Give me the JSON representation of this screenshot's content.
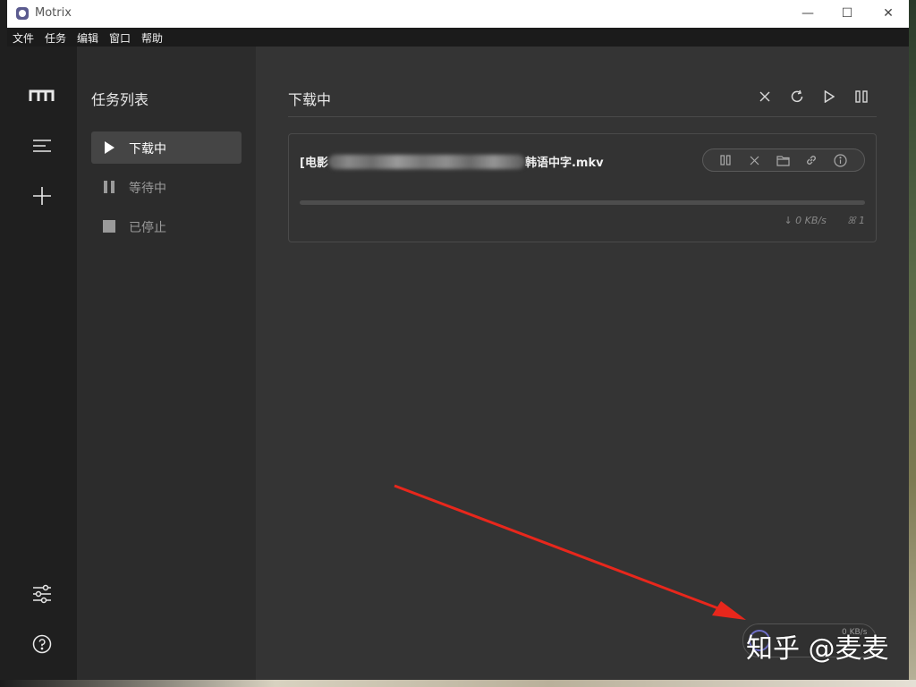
{
  "window": {
    "title": "Motrix",
    "minimize_glyph": "—",
    "maximize_glyph": "☐",
    "close_glyph": "✕"
  },
  "menubar": {
    "items": [
      "文件",
      "任务",
      "编辑",
      "窗口",
      "帮助"
    ]
  },
  "rail": {
    "icons": [
      "motrix-logo-icon",
      "menu-icon",
      "add-icon",
      "preferences-icon",
      "help-icon"
    ]
  },
  "task_panel": {
    "title": "任务列表",
    "items": [
      {
        "label": "下载中",
        "icon": "play-icon",
        "active": true
      },
      {
        "label": "等待中",
        "icon": "pause-icon",
        "active": false
      },
      {
        "label": "已停止",
        "icon": "stop-icon",
        "active": false
      }
    ]
  },
  "main": {
    "title": "下载中",
    "toolbar": [
      "close-icon",
      "refresh-icon",
      "play-icon",
      "pause-icon"
    ]
  },
  "task": {
    "name_prefix": "[电影",
    "name_suffix": "韩语中字.mkv",
    "progress": 0,
    "speed": "↓ 0 KB/s",
    "connections": "1",
    "actions": [
      "pause-icon",
      "delete-icon",
      "folder-icon",
      "link-icon",
      "info-icon"
    ]
  },
  "speedometer": {
    "speed": "0 KB/s"
  },
  "watermark": "知乎 @麦麦",
  "colors": {
    "arrow": "#e8271c",
    "accent": "#5b5bd6"
  }
}
